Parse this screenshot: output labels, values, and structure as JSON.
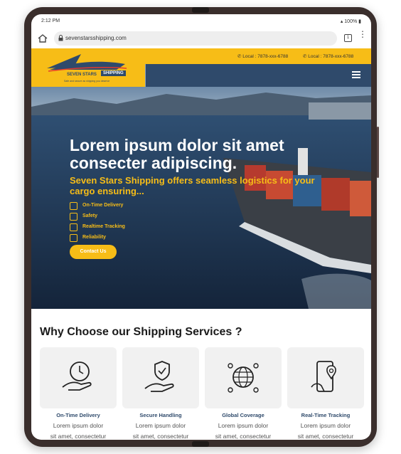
{
  "status": {
    "time": "2:12 PM",
    "battery": "100%"
  },
  "browser": {
    "url": "sevenstarsshipping.com",
    "tabs_count": "1"
  },
  "header": {
    "brand_line1": "SEVEN STARS",
    "brand_line2": "SHIPPING",
    "tagline": "Safe and secure as shipping you deserve",
    "contacts": [
      "Local : 7878-xxx-6788",
      "Local : 7878-xxx-6788"
    ]
  },
  "hero": {
    "title": "Lorem ipsum dolor sit amet consecter adipiscing.",
    "subtitle": "Seven Stars Shipping offers seamless logistics for your cargo ensuring...",
    "checklist": [
      "On-Time Delivery",
      "Safety",
      "Realtime Tracking",
      "Reliability"
    ],
    "cta_label": "Contact Us"
  },
  "why": {
    "title": "Why Choose our Shipping Services ?",
    "cards": [
      {
        "icon": "delivery-clock-hand-icon",
        "title": "On-Time Delivery",
        "line1": "Lorem ipsum dolor",
        "line2": "sit amet, consectetur"
      },
      {
        "icon": "shield-hand-icon",
        "title": "Secure Handling",
        "line1": "Lorem ipsum dolor",
        "line2": "sit amet, consectetur"
      },
      {
        "icon": "globe-network-icon",
        "title": "Global Coverage",
        "line1": "Lorem ipsum dolor",
        "line2": "sit amet, consectetur"
      },
      {
        "icon": "phone-location-icon",
        "title": "Real-Time Tracking",
        "line1": "Lorem ipsum dolor",
        "line2": "sit amet, consectetur"
      }
    ]
  },
  "colors": {
    "accent": "#f7bd17",
    "navy": "#2f4a6b"
  }
}
